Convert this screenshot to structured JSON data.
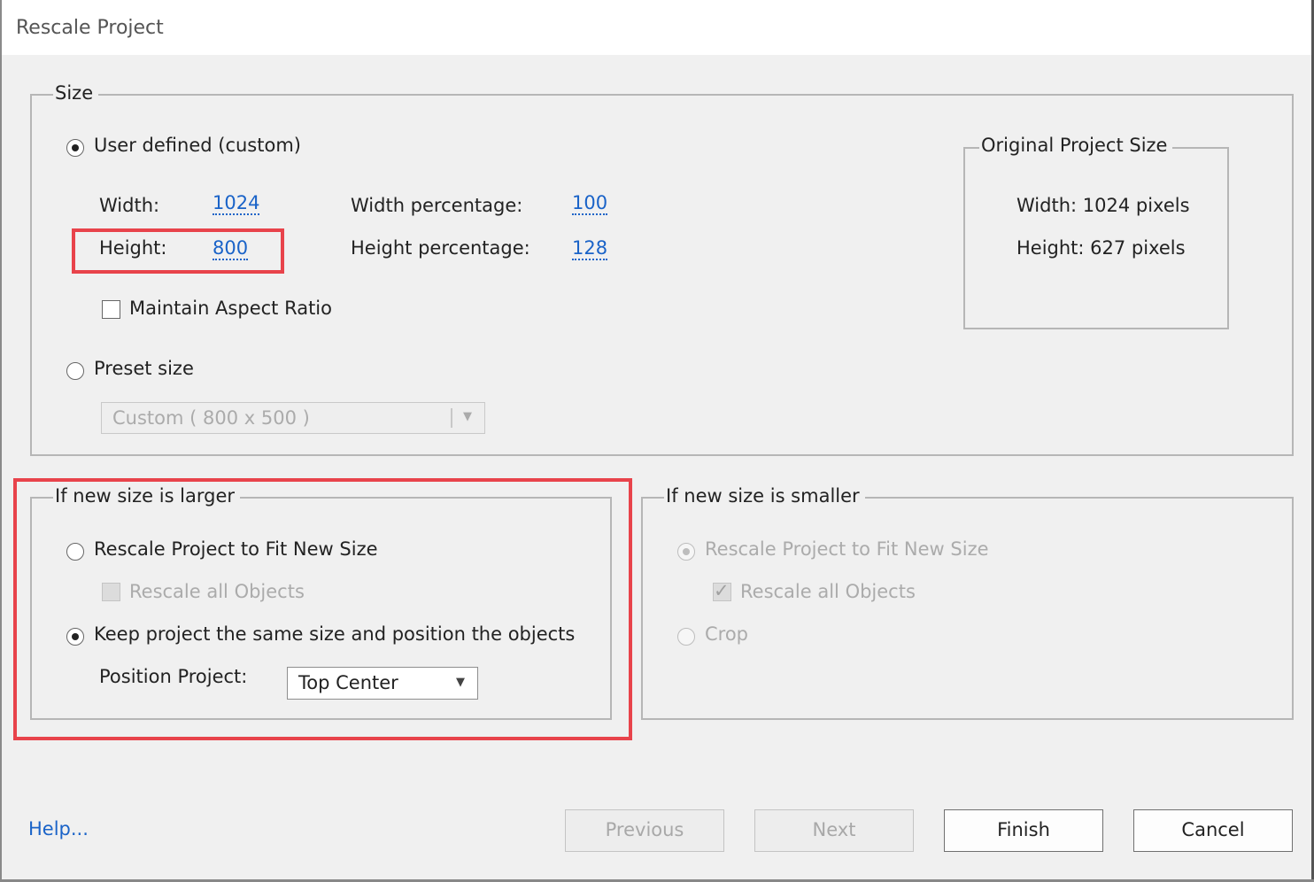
{
  "window": {
    "title": "Rescale Project"
  },
  "size_group": {
    "legend": "Size",
    "user_defined_label": "User defined (custom)",
    "width_label": "Width:",
    "width_value": "1024",
    "height_label": "Height:",
    "height_value": "800",
    "width_pct_label": "Width percentage:",
    "width_pct_value": "100",
    "height_pct_label": "Height percentage:",
    "height_pct_value": "128",
    "maintain_aspect_label": "Maintain Aspect Ratio",
    "preset_size_label": "Preset size",
    "preset_dropdown_value": "Custom ( 800 x 500 )"
  },
  "original_size_group": {
    "legend": "Original Project Size",
    "width_text": "Width: 1024 pixels",
    "height_text": "Height: 627 pixels"
  },
  "larger_group": {
    "legend": "If new size is larger",
    "rescale_fit_label": "Rescale Project to Fit New Size",
    "rescale_objects_label": "Rescale all Objects",
    "keep_same_label": "Keep project the same size and position the objects",
    "position_label": "Position Project:",
    "position_value": "Top Center"
  },
  "smaller_group": {
    "legend": "If new size is smaller",
    "rescale_fit_label": "Rescale Project to Fit New Size",
    "rescale_objects_label": "Rescale all Objects",
    "crop_label": "Crop"
  },
  "footer": {
    "help_label": "Help...",
    "previous_label": "Previous",
    "next_label": "Next",
    "finish_label": "Finish",
    "cancel_label": "Cancel"
  },
  "colors": {
    "highlight": "#e8434b",
    "link": "#1a63c8",
    "background": "#f0f0f0"
  },
  "icons": {
    "dropdown_arrow": "triangle-down-icon",
    "checkmark": "checkmark-icon"
  }
}
